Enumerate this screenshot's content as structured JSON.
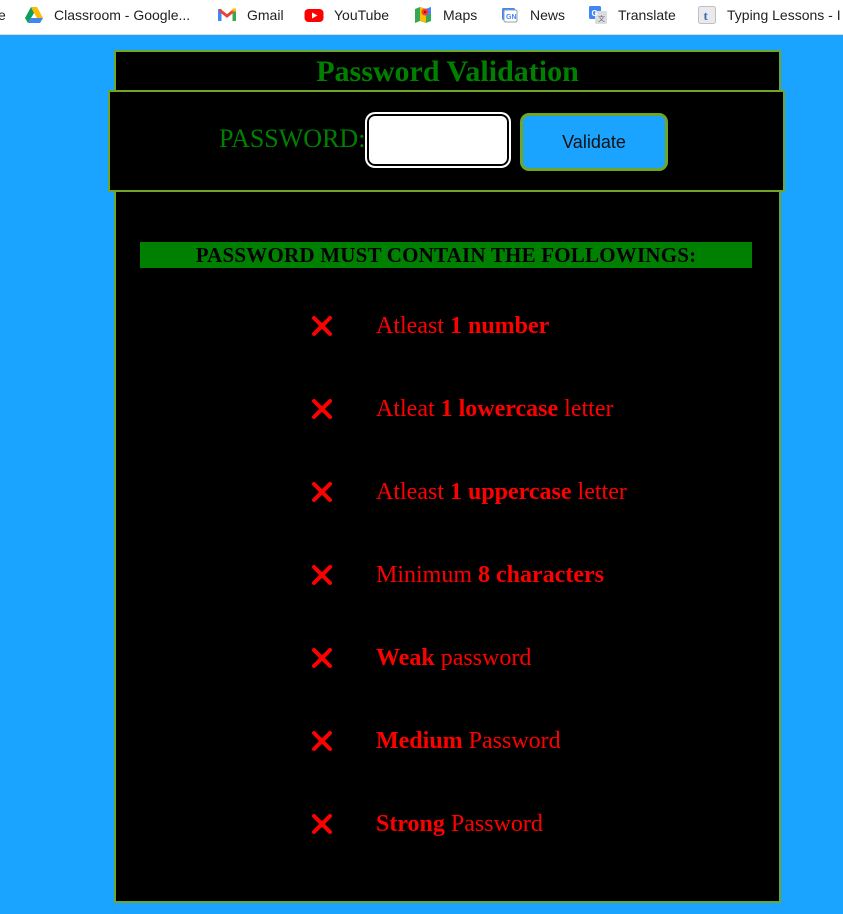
{
  "bookmarks": [
    {
      "label": "e",
      "icon": "partial-bookmark-icon"
    },
    {
      "label": "Classroom - Google...",
      "icon": "google-drive-icon"
    },
    {
      "label": "Gmail",
      "icon": "gmail-icon"
    },
    {
      "label": "YouTube",
      "icon": "youtube-icon"
    },
    {
      "label": "Maps",
      "icon": "google-maps-icon"
    },
    {
      "label": "News",
      "icon": "google-news-icon"
    },
    {
      "label": "Translate",
      "icon": "google-translate-icon"
    },
    {
      "label": "Typing Lessons - I",
      "icon": "typing-lessons-icon"
    }
  ],
  "page": {
    "title": "Password Validation",
    "form": {
      "label": "PASSWORD:",
      "value": "",
      "button": "Validate"
    },
    "requirements_heading": "PASSWORD MUST CONTAIN THE FOLLOWINGS:",
    "requirements": [
      {
        "pre": "Atleast ",
        "bold": "1 number",
        "post": "",
        "icon": "cross-icon"
      },
      {
        "pre": "Atleat ",
        "bold": "1 lowercase",
        "post": " letter",
        "icon": "cross-icon"
      },
      {
        "pre": "Atleast ",
        "bold": "1 uppercase",
        "post": " letter",
        "icon": "cross-icon"
      },
      {
        "pre": "Minimum ",
        "bold": "8 characters",
        "post": "",
        "icon": "cross-icon"
      },
      {
        "pre": "",
        "bold": "Weak",
        "post": " password",
        "icon": "cross-icon"
      },
      {
        "pre": "",
        "bold": "Medium",
        "post": " Password",
        "icon": "cross-icon"
      },
      {
        "pre": "",
        "bold": "Strong",
        "post": " Password",
        "icon": "cross-icon"
      }
    ]
  },
  "colors": {
    "page_background": "#1aa3ff",
    "panel_background": "#000000",
    "title_green": "#008000",
    "border_green": "#6fa62a",
    "requirement_red": "#ff0000",
    "button_blue": "#1aa3ff"
  }
}
